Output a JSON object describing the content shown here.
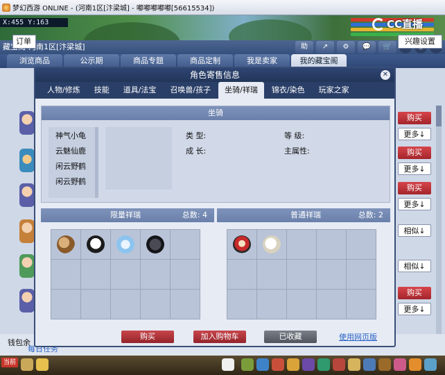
{
  "window": {
    "title": "梦幻西游 ONLINE - (河南1区[汴梁城] - 嘟嘟嘟嘟嘟[56615534])"
  },
  "hud": {
    "coords": "X:455 Y:163",
    "stream_logo": "CC直播"
  },
  "cbg": {
    "title": "藏宝阁-河南1区[汴梁城]",
    "toolbar": [
      "助",
      "↗",
      "⚙",
      "💬",
      "🛒"
    ],
    "tabs": [
      "浏览商品",
      "公示期",
      "商品专题",
      "商品定制",
      "我是卖家",
      "我的藏宝阁"
    ],
    "order_label": "订单",
    "interest_label": "兴趣设置",
    "buttons": [
      {
        "label": "购买",
        "kind": "buy"
      },
      {
        "label": "更多↓",
        "kind": "more"
      },
      {
        "label": "购买",
        "kind": "buy"
      },
      {
        "label": "更多↓",
        "kind": "more"
      },
      {
        "label": "购买",
        "kind": "buy"
      },
      {
        "label": "更多↓",
        "kind": "more"
      },
      {
        "label": "相似↓",
        "kind": "more"
      },
      {
        "label": "相似↓",
        "kind": "more"
      },
      {
        "label": "购买",
        "kind": "buy"
      },
      {
        "label": "更多↓",
        "kind": "more"
      }
    ],
    "money_label": "钱包余",
    "task_link": "每日任务"
  },
  "dialog": {
    "title": "角色寄售信息",
    "close": "✕",
    "tabs": [
      "人物/修炼",
      "技能",
      "道具/法宝",
      "召唤兽/孩子",
      "坐骑/祥瑞",
      "锦衣/染色",
      "玩家之家"
    ],
    "active_tab": 4,
    "mount_header": "坐骑",
    "mounts": [
      "神气小龟",
      "云魅仙鹿",
      "闲云野鹤",
      "闲云野鹤"
    ],
    "attrs": {
      "type_label": "类  型:",
      "grow_label": "成  长:",
      "level_label": "等  级:",
      "main_attr_label": "主属性:"
    },
    "limited": {
      "label": "限量祥瑞",
      "count_label": "总数:",
      "count": "4"
    },
    "normal": {
      "label": "普通祥瑞",
      "count_label": "总数:",
      "count": "2"
    },
    "limited_items": [
      "reindeer-icon",
      "panda-icon",
      "cloud-beast-icon",
      "black-crow-icon"
    ],
    "normal_items": [
      "lion-dance-icon",
      "moon-orb-icon"
    ],
    "buttons": {
      "buy": "购买",
      "cart": "加入购物车",
      "fav": "已收藏"
    },
    "web_link": "使用网页版"
  },
  "gamebar": {
    "chat_tag": "当前"
  },
  "colors": {
    "buy_red": "#b7333a",
    "link_blue": "#2a63c5",
    "header_navy": "#2f4572"
  }
}
